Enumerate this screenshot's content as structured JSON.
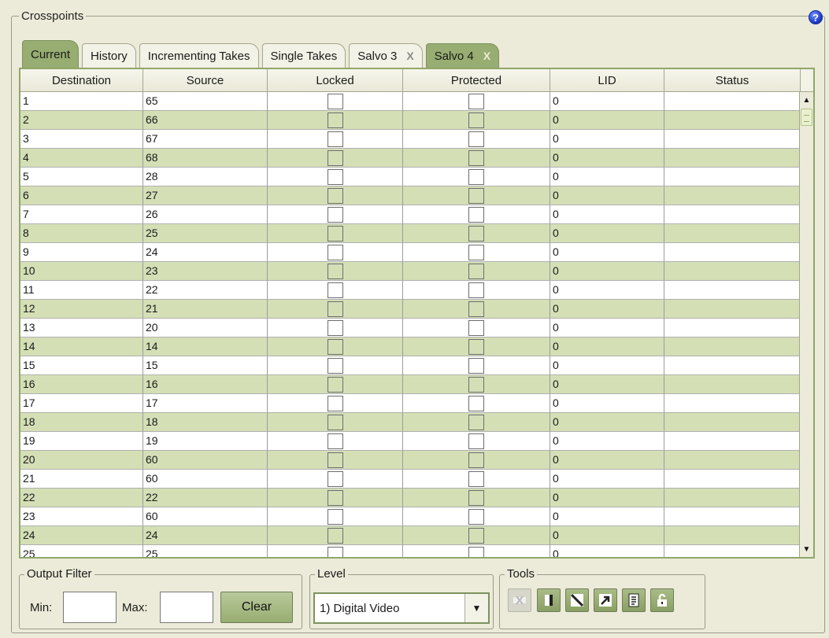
{
  "panel": {
    "title": "Crosspoints",
    "help_icon": "?"
  },
  "tabs": [
    {
      "label": "Current",
      "closable": false
    },
    {
      "label": "History",
      "closable": false
    },
    {
      "label": "Incrementing Takes",
      "closable": false
    },
    {
      "label": "Single Takes",
      "closable": false
    },
    {
      "label": "Salvo 3",
      "closable": true
    },
    {
      "label": "Salvo 4",
      "closable": true
    }
  ],
  "tab_close_glyph": "X",
  "table": {
    "columns": [
      "Destination",
      "Source",
      "Locked",
      "Protected",
      "LID",
      "Status"
    ],
    "rows": [
      {
        "dest": "1",
        "src": "65",
        "lid": "0"
      },
      {
        "dest": "2",
        "src": "66",
        "lid": "0"
      },
      {
        "dest": "3",
        "src": "67",
        "lid": "0"
      },
      {
        "dest": "4",
        "src": "68",
        "lid": "0"
      },
      {
        "dest": "5",
        "src": "28",
        "lid": "0"
      },
      {
        "dest": "6",
        "src": "27",
        "lid": "0"
      },
      {
        "dest": "7",
        "src": "26",
        "lid": "0"
      },
      {
        "dest": "8",
        "src": "25",
        "lid": "0"
      },
      {
        "dest": "9",
        "src": "24",
        "lid": "0"
      },
      {
        "dest": "10",
        "src": "23",
        "lid": "0"
      },
      {
        "dest": "11",
        "src": "22",
        "lid": "0"
      },
      {
        "dest": "12",
        "src": "21",
        "lid": "0"
      },
      {
        "dest": "13",
        "src": "20",
        "lid": "0"
      },
      {
        "dest": "14",
        "src": "14",
        "lid": "0"
      },
      {
        "dest": "15",
        "src": "15",
        "lid": "0"
      },
      {
        "dest": "16",
        "src": "16",
        "lid": "0"
      },
      {
        "dest": "17",
        "src": "17",
        "lid": "0"
      },
      {
        "dest": "18",
        "src": "18",
        "lid": "0"
      },
      {
        "dest": "19",
        "src": "19",
        "lid": "0"
      },
      {
        "dest": "20",
        "src": "60",
        "lid": "0"
      },
      {
        "dest": "21",
        "src": "60",
        "lid": "0"
      },
      {
        "dest": "22",
        "src": "22",
        "lid": "0"
      },
      {
        "dest": "23",
        "src": "60",
        "lid": "0"
      },
      {
        "dest": "24",
        "src": "24",
        "lid": "0"
      },
      {
        "dest": "25",
        "src": "25",
        "lid": "0"
      }
    ]
  },
  "output_filter": {
    "title": "Output Filter",
    "min_label": "Min:",
    "max_label": "Max:",
    "min_value": "",
    "max_value": "",
    "clear_label": "Clear"
  },
  "level": {
    "title": "Level",
    "selected": "1) Digital Video"
  },
  "tools": {
    "title": "Tools",
    "icons": [
      "disconnect-icon",
      "lock-icon",
      "diagonal-icon",
      "arrow-out-icon",
      "document-icon",
      "unlock-icon"
    ]
  },
  "colors": {
    "accent_green": "#97ad71",
    "row_alt": "#d4dfb6",
    "background": "#ecebd9"
  }
}
